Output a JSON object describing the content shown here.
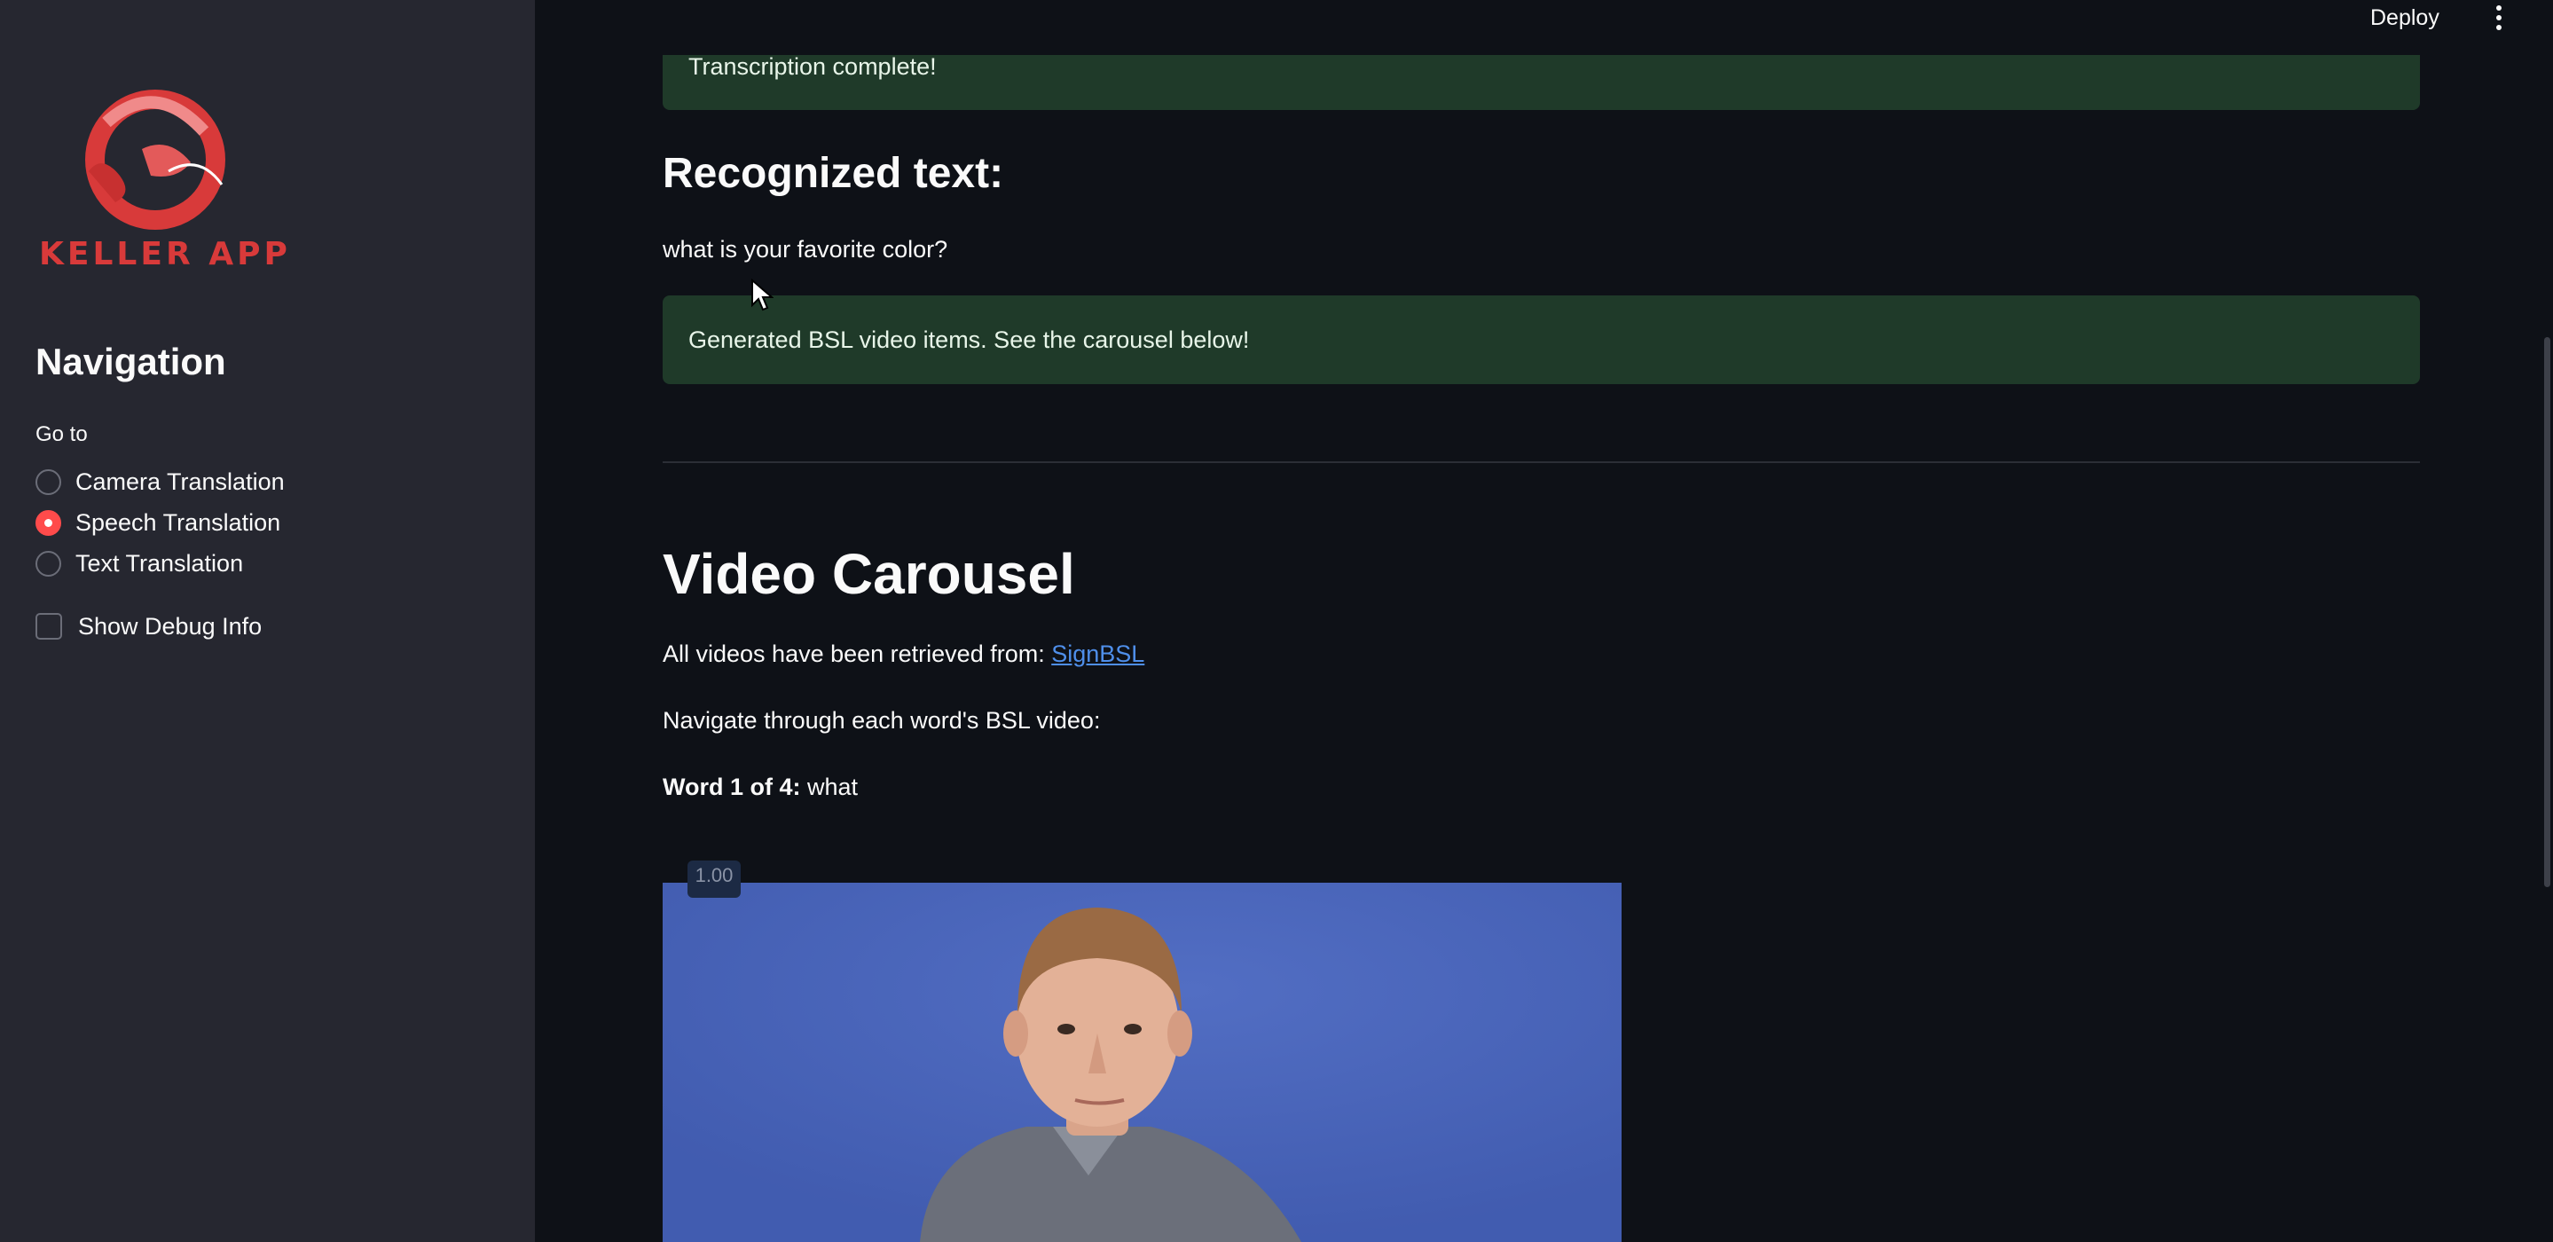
{
  "sidebar": {
    "logo_text": "KELLER APP",
    "nav_title": "Navigation",
    "goto_label": "Go to",
    "options": [
      {
        "label": "Camera Translation",
        "selected": false
      },
      {
        "label": "Speech Translation",
        "selected": true
      },
      {
        "label": "Text Translation",
        "selected": false
      }
    ],
    "debug_label": "Show Debug Info",
    "debug_checked": false
  },
  "topbar": {
    "deploy_label": "Deploy",
    "menu_icon": "vertical-ellipsis-icon"
  },
  "main": {
    "transcription_alert": "Transcription complete!",
    "recognized_heading": "Recognized text:",
    "recognized_value": "what is your favorite color?",
    "generated_alert": "Generated BSL video items. See the carousel below!",
    "carousel_heading": "Video Carousel",
    "retrieved_prefix": "All videos have been retrieved from: ",
    "retrieved_link": "SignBSL",
    "navigate_text": "Navigate through each word's BSL video:",
    "word_label": "Word 1 of 4:",
    "word_value": " what",
    "video_speed": "1.00"
  },
  "colors": {
    "sidebar_bg": "#262730",
    "main_bg": "#0e1117",
    "accent": "#ff4b4b",
    "success_bg": "#1f3a29",
    "link": "#4f8fea",
    "video_bg": "#4561b8"
  }
}
